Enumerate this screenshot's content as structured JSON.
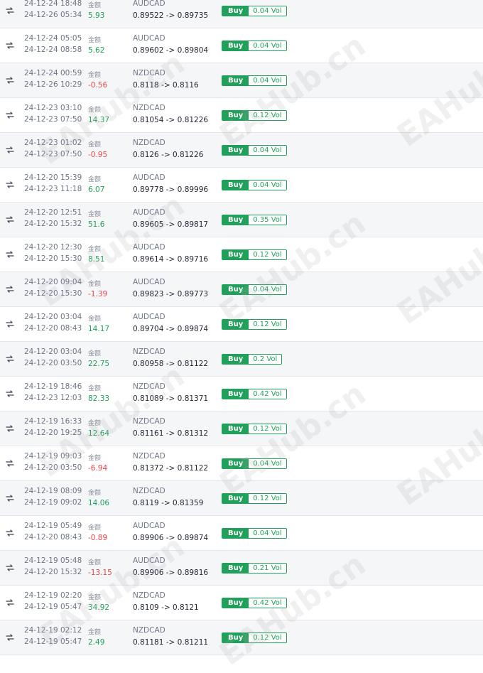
{
  "amount_label": "金额",
  "trades": [
    {
      "open": "24-12-24 18:48",
      "close": "24-12-26 05:34",
      "amount": "5.93",
      "positive": true,
      "symbol": "AUDCAD",
      "prices": "0.89522 -> 0.89735",
      "side": "Buy",
      "volume": "0.04 Vol"
    },
    {
      "open": "24-12-24 05:05",
      "close": "24-12-24 08:58",
      "amount": "5.62",
      "positive": true,
      "symbol": "AUDCAD",
      "prices": "0.89602 -> 0.89804",
      "side": "Buy",
      "volume": "0.04 Vol"
    },
    {
      "open": "24-12-24 00:59",
      "close": "24-12-26 10:29",
      "amount": "-0.56",
      "positive": false,
      "symbol": "NZDCAD",
      "prices": "0.8118 -> 0.8116",
      "side": "Buy",
      "volume": "0.04 Vol"
    },
    {
      "open": "24-12-23 03:10",
      "close": "24-12-23 07:50",
      "amount": "14.37",
      "positive": true,
      "symbol": "NZDCAD",
      "prices": "0.81054 -> 0.81226",
      "side": "Buy",
      "volume": "0.12 Vol"
    },
    {
      "open": "24-12-23 01:02",
      "close": "24-12-23 07:50",
      "amount": "-0.95",
      "positive": false,
      "symbol": "NZDCAD",
      "prices": "0.8126 -> 0.81226",
      "side": "Buy",
      "volume": "0.04 Vol"
    },
    {
      "open": "24-12-20 15:39",
      "close": "24-12-23 11:18",
      "amount": "6.07",
      "positive": true,
      "symbol": "AUDCAD",
      "prices": "0.89778 -> 0.89996",
      "side": "Buy",
      "volume": "0.04 Vol"
    },
    {
      "open": "24-12-20 12:51",
      "close": "24-12-20 15:32",
      "amount": "51.6",
      "positive": true,
      "symbol": "AUDCAD",
      "prices": "0.89605 -> 0.89817",
      "side": "Buy",
      "volume": "0.35 Vol"
    },
    {
      "open": "24-12-20 12:30",
      "close": "24-12-20 15:30",
      "amount": "8.51",
      "positive": true,
      "symbol": "AUDCAD",
      "prices": "0.89614 -> 0.89716",
      "side": "Buy",
      "volume": "0.12 Vol"
    },
    {
      "open": "24-12-20 09:04",
      "close": "24-12-20 15:30",
      "amount": "-1.39",
      "positive": false,
      "symbol": "AUDCAD",
      "prices": "0.89823 -> 0.89773",
      "side": "Buy",
      "volume": "0.04 Vol"
    },
    {
      "open": "24-12-20 03:04",
      "close": "24-12-20 08:43",
      "amount": "14.17",
      "positive": true,
      "symbol": "AUDCAD",
      "prices": "0.89704 -> 0.89874",
      "side": "Buy",
      "volume": "0.12 Vol"
    },
    {
      "open": "24-12-20 03:04",
      "close": "24-12-20 03:50",
      "amount": "22.75",
      "positive": true,
      "symbol": "NZDCAD",
      "prices": "0.80958 -> 0.81122",
      "side": "Buy",
      "volume": "0.2 Vol"
    },
    {
      "open": "24-12-19 18:46",
      "close": "24-12-23 12:03",
      "amount": "82.33",
      "positive": true,
      "symbol": "NZDCAD",
      "prices": "0.81089 -> 0.81371",
      "side": "Buy",
      "volume": "0.42 Vol"
    },
    {
      "open": "24-12-19 16:33",
      "close": "24-12-20 19:25",
      "amount": "12.64",
      "positive": true,
      "symbol": "NZDCAD",
      "prices": "0.81161 -> 0.81312",
      "side": "Buy",
      "volume": "0.12 Vol"
    },
    {
      "open": "24-12-19 09:03",
      "close": "24-12-20 03:50",
      "amount": "-6.94",
      "positive": false,
      "symbol": "NZDCAD",
      "prices": "0.81372 -> 0.81122",
      "side": "Buy",
      "volume": "0.04 Vol"
    },
    {
      "open": "24-12-19 08:09",
      "close": "24-12-19 09:02",
      "amount": "14.06",
      "positive": true,
      "symbol": "NZDCAD",
      "prices": "0.8119 -> 0.81359",
      "side": "Buy",
      "volume": "0.12 Vol"
    },
    {
      "open": "24-12-19 05:49",
      "close": "24-12-20 08:43",
      "amount": "-0.89",
      "positive": false,
      "symbol": "AUDCAD",
      "prices": "0.89906 -> 0.89874",
      "side": "Buy",
      "volume": "0.04 Vol"
    },
    {
      "open": "24-12-19 05:48",
      "close": "24-12-20 15:32",
      "amount": "-13.15",
      "positive": false,
      "symbol": "AUDCAD",
      "prices": "0.89906 -> 0.89816",
      "side": "Buy",
      "volume": "0.21 Vol"
    },
    {
      "open": "24-12-19 02:20",
      "close": "24-12-19 05:47",
      "amount": "34.92",
      "positive": true,
      "symbol": "NZDCAD",
      "prices": "0.8109 -> 0.8121",
      "side": "Buy",
      "volume": "0.42 Vol"
    },
    {
      "open": "24-12-19 02:12",
      "close": "24-12-19 05:47",
      "amount": "2.49",
      "positive": true,
      "symbol": "NZDCAD",
      "prices": "0.81181 -> 0.81211",
      "side": "Buy",
      "volume": "0.12 Vol"
    }
  ],
  "watermark": "EAHub.cn",
  "colors": {
    "buy": "#21a05b",
    "profit": "#21a05b",
    "loss": "#e2474c",
    "row_alt": "#f5f6f8"
  }
}
